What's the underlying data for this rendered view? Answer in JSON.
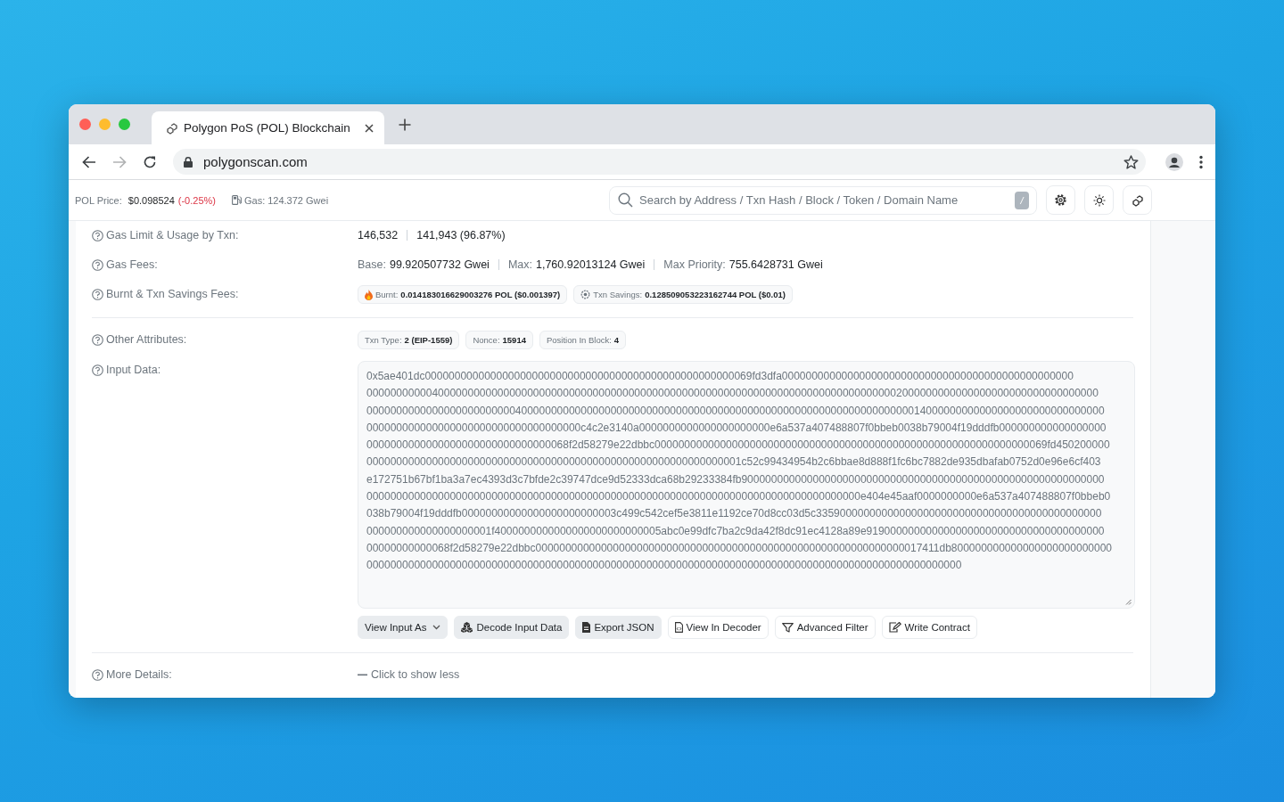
{
  "browser": {
    "tabs": [
      {
        "title": "Polygon PoS (POL) Blockchain",
        "selected": true
      }
    ],
    "url": "polygonscan.com",
    "back_disabled": false,
    "forward_disabled": true
  },
  "header": {
    "price_label": "POL Price:",
    "price": "$0.098524",
    "change": "(-0.25%)",
    "gas_label": "Gas:",
    "gas": "124.372 Gwei",
    "search": {
      "placeholder": "Search by Address / Txn Hash / Block / Token / Domain Name"
    },
    "shortcut_key": "/"
  },
  "details": [
    {
      "kind": "pair",
      "label": "Gas Limit & Usage by Txn:",
      "values": [
        "146,532",
        "141,943 (96.87%)"
      ]
    },
    {
      "kind": "fees",
      "label": "Gas Fees:",
      "parts": [
        {
          "name": "Base:",
          "value": "99.920507732 Gwei"
        },
        {
          "name": "Max:",
          "value": "1,760.92013124 Gwei"
        },
        {
          "name": "Max Priority:",
          "value": "755.6428731 Gwei"
        }
      ]
    },
    {
      "kind": "badges",
      "label": "Burnt & Txn Savings Fees:",
      "divider_after": true,
      "badges": [
        {
          "kind": "burnt",
          "name": "Burnt:",
          "value": "0.014183016629003276 POL ($0.001397)"
        },
        {
          "kind": "savings",
          "name": "Txn Savings:",
          "value": "0.128509053223162744 POL ($0.01)"
        }
      ]
    },
    {
      "kind": "badges",
      "label": "Other Attributes:",
      "badges": [
        {
          "name": "Txn Type:",
          "value": "2 (EIP-1559)"
        },
        {
          "name": "Nonce:",
          "value": "15914"
        },
        {
          "name": "Position In Block:",
          "value": "4"
        }
      ]
    },
    {
      "kind": "input",
      "label": "Input Data:",
      "divider_after": true,
      "lines": [
        "0x5ae401dc0000000000000000000000000000000000000000000000000000069fd3dfa0000000000000000000000000000000000000000000000000",
        "000000000004000000000000000000000000000000000000000000000000000000000000000000000000000002000000000000000000000000000000000",
        "0000000000000000000000000400000000000000000000000000000000000000000000000000000000000000000014000000000000000000000000000000",
        "000000000000000000000000000000000000c4c2e3140a0000000000000000000000e6a537a407488807f0bbeb0038b79004f19dddfb000000000000000000",
        "0000000000000000000000000000000068f2d58279e22dbbc000000000000000000000000000000000000000000000000000000000000000069fd450200000",
        "000000000000000000000000000000000000000000000000000000000000001c52c99434954b2c6bbae8d888f1fc6bc7882de935dbafab0752d0e96e6cf403",
        "e172751b67bf1ba3a7ec4393d3c7bfde2c39747dce9d52333dca68b29233384fb9000000000000000000000000000000000000000000000000000000000000",
        "00000000000000000000000000000000000000000000000000000000000000000000000000000000000e404e45aaf0000000000e6a537a407488807f0bbeb0",
        "038b79004f19dddfb00000000000000000000000003c499c542cef5e3811e1192ce70d8cc03d5c335900000000000000000000000000000000000000000000",
        "000000000000000000001f4000000000000000000000000005abc0e99dfc7ba2c9da42f8dc91ec4128a89e9190000000000000000000000000000000000000",
        "00000000000068f2d58279e22dbbc00000000000000000000000000000000000000000000000000000000000000017411db800000000000000000000000000",
        "0000000000000000000000000000000000000000000000000000000000000000000000000000000000000000000000000000"
      ],
      "buttons": [
        {
          "label": "View Input As",
          "kind": "filled"
        },
        {
          "label": "Decode Input Data",
          "kind": "filled"
        },
        {
          "label": "Export JSON",
          "kind": "filled"
        },
        {
          "label": "View In Decoder",
          "kind": "outline"
        },
        {
          "label": "Advanced Filter",
          "kind": "outline"
        },
        {
          "label": "Write Contract",
          "kind": "outline"
        }
      ]
    },
    {
      "kind": "link",
      "label": "More Details:",
      "link": "Click to show less"
    }
  ]
}
